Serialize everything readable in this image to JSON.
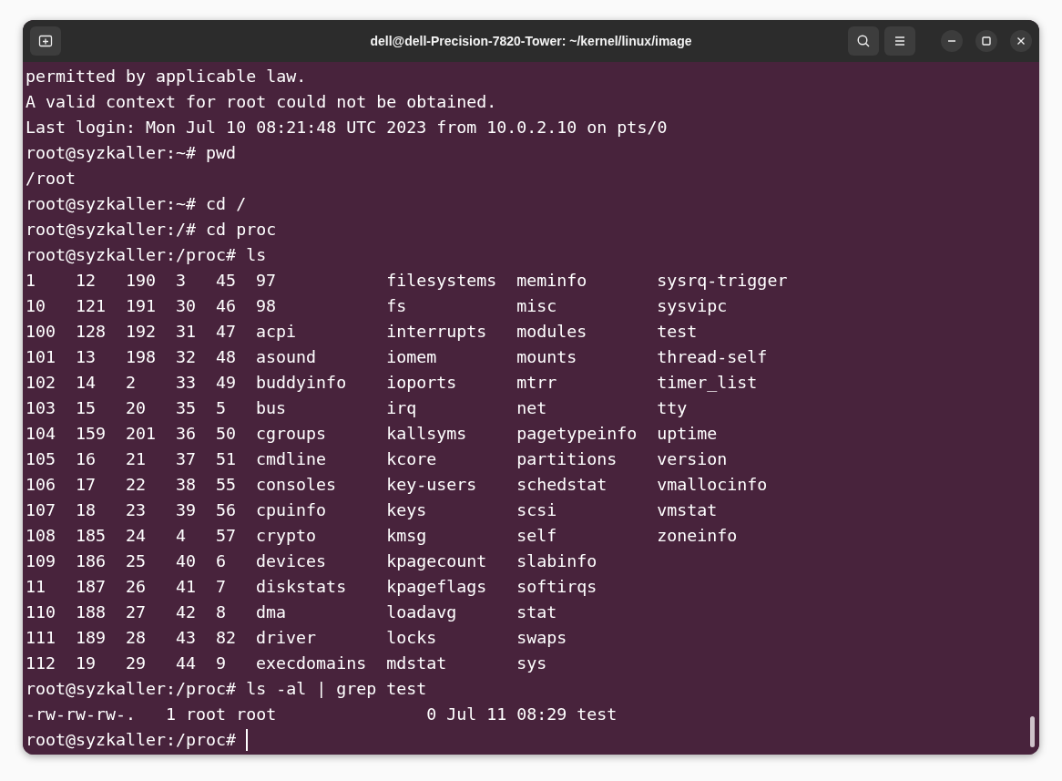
{
  "window": {
    "title": "dell@dell-Precision-7820-Tower: ~/kernel/linux/image"
  },
  "terminal": {
    "lines_before": [
      "permitted by applicable law.",
      "A valid context for root could not be obtained.",
      "Last login: Mon Jul 10 08:21:48 UTC 2023 from 10.0.2.10 on pts/0",
      "root@syzkaller:~# pwd",
      "/root",
      "root@syzkaller:~# cd /",
      "root@syzkaller:/# cd proc",
      "root@syzkaller:/proc# ls"
    ],
    "listing": [
      [
        "1",
        "12",
        "190",
        "3",
        "45",
        "97",
        "filesystems",
        "meminfo",
        "sysrq-trigger"
      ],
      [
        "10",
        "121",
        "191",
        "30",
        "46",
        "98",
        "fs",
        "misc",
        "sysvipc"
      ],
      [
        "100",
        "128",
        "192",
        "31",
        "47",
        "acpi",
        "interrupts",
        "modules",
        "test"
      ],
      [
        "101",
        "13",
        "198",
        "32",
        "48",
        "asound",
        "iomem",
        "mounts",
        "thread-self"
      ],
      [
        "102",
        "14",
        "2",
        "33",
        "49",
        "buddyinfo",
        "ioports",
        "mtrr",
        "timer_list"
      ],
      [
        "103",
        "15",
        "20",
        "35",
        "5",
        "bus",
        "irq",
        "net",
        "tty"
      ],
      [
        "104",
        "159",
        "201",
        "36",
        "50",
        "cgroups",
        "kallsyms",
        "pagetypeinfo",
        "uptime"
      ],
      [
        "105",
        "16",
        "21",
        "37",
        "51",
        "cmdline",
        "kcore",
        "partitions",
        "version"
      ],
      [
        "106",
        "17",
        "22",
        "38",
        "55",
        "consoles",
        "key-users",
        "schedstat",
        "vmallocinfo"
      ],
      [
        "107",
        "18",
        "23",
        "39",
        "56",
        "cpuinfo",
        "keys",
        "scsi",
        "vmstat"
      ],
      [
        "108",
        "185",
        "24",
        "4",
        "57",
        "crypto",
        "kmsg",
        "self",
        "zoneinfo"
      ],
      [
        "109",
        "186",
        "25",
        "40",
        "6",
        "devices",
        "kpagecount",
        "slabinfo"
      ],
      [
        "11",
        "187",
        "26",
        "41",
        "7",
        "diskstats",
        "kpageflags",
        "softirqs"
      ],
      [
        "110",
        "188",
        "27",
        "42",
        "8",
        "dma",
        "loadavg",
        "stat"
      ],
      [
        "111",
        "189",
        "28",
        "43",
        "82",
        "driver",
        "locks",
        "swaps"
      ],
      [
        "112",
        "19",
        "29",
        "44",
        "9",
        "execdomains",
        "mdstat",
        "sys"
      ]
    ],
    "lines_after": [
      "root@syzkaller:/proc# ls -al | grep test",
      "-rw-rw-rw-.   1 root root               0 Jul 11 08:29 test"
    ],
    "prompt": "root@syzkaller:/proc# "
  }
}
